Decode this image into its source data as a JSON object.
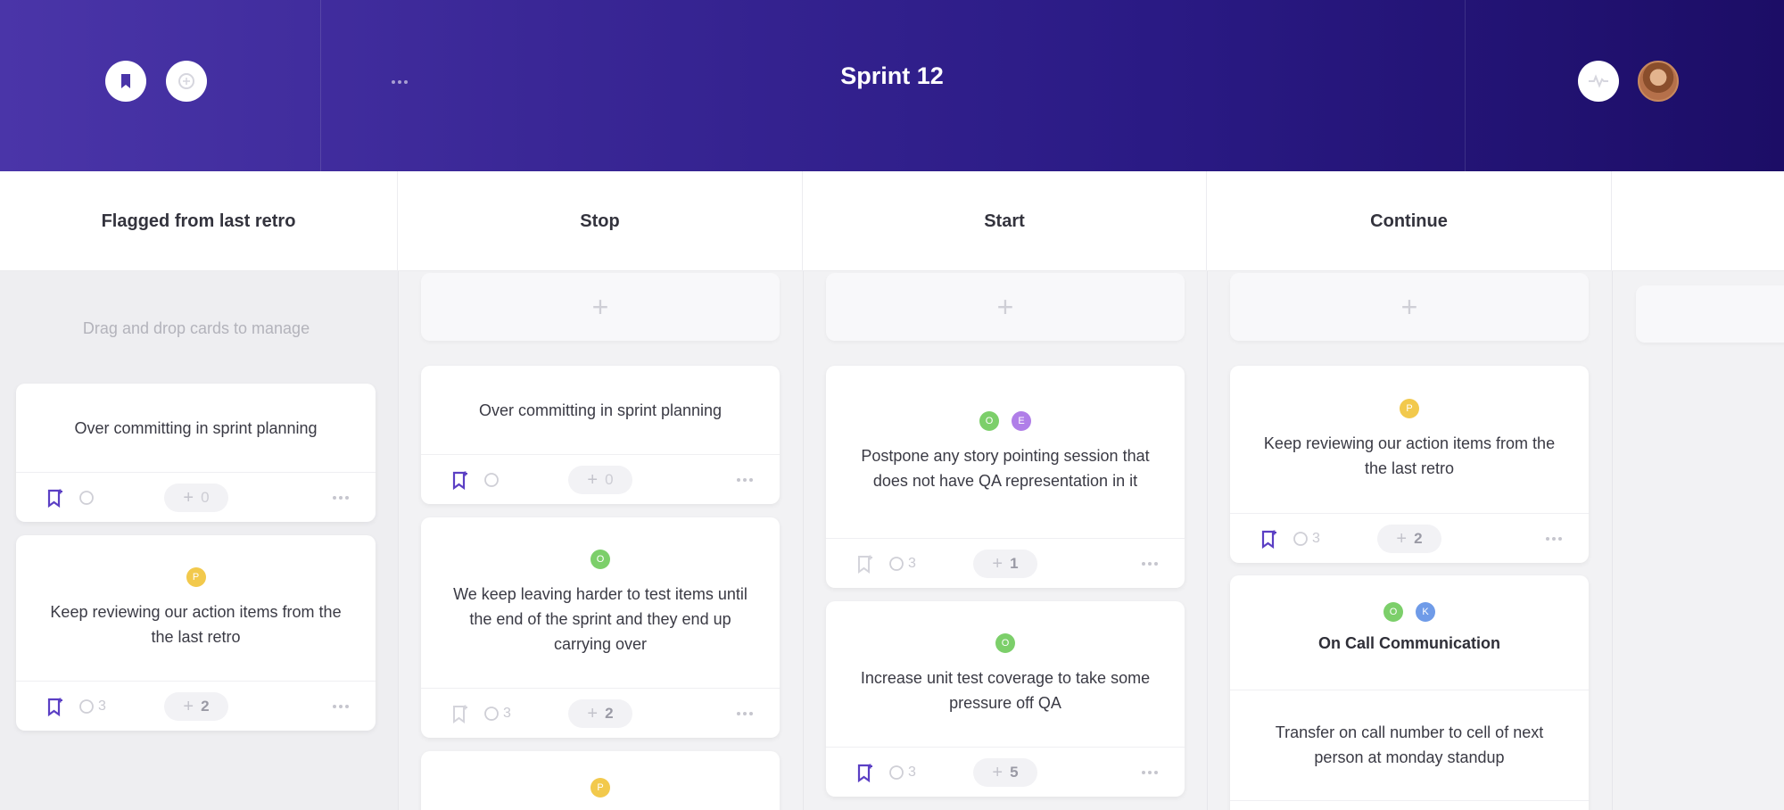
{
  "header": {
    "title": "Sprint 12",
    "left_buttons": [
      {
        "icon": "bookmark-icon"
      },
      {
        "icon": "chat-bubble-icon"
      }
    ],
    "more_icon": "more-dots-icon",
    "right": {
      "activity_icon": "activity-pulse-icon",
      "avatar": "user-avatar"
    }
  },
  "columns": [
    {
      "title": "Flagged from last retro",
      "hint": "Drag and drop cards to manage"
    },
    {
      "title": "Stop"
    },
    {
      "title": "Start"
    },
    {
      "title": "Continue"
    }
  ],
  "add_card_symbol": "+",
  "cards": {
    "flagged": [
      {
        "text": "Over committing in sprint planning",
        "comments": "",
        "votes": "0"
      },
      {
        "users": [
          "P"
        ],
        "text": "Keep reviewing our action items from the the last retro",
        "comments": "3",
        "votes": "2"
      }
    ],
    "stop": [
      {
        "text": "Over committing in sprint planning",
        "comments": "",
        "votes": "0"
      },
      {
        "users": [
          "O"
        ],
        "text": "We keep leaving harder to test items until the end of the sprint and they end up carrying over",
        "comments": "3",
        "votes": "2"
      },
      {
        "users": [
          "P"
        ]
      }
    ],
    "start": [
      {
        "users": [
          "O",
          "E"
        ],
        "text": "Postpone any story pointing session that does not have QA representation in it",
        "comments": "3",
        "votes": "1"
      },
      {
        "users": [
          "O"
        ],
        "text": "Increase unit test coverage to take some pressure off QA",
        "comments": "3",
        "votes": "5"
      }
    ],
    "continue": [
      {
        "users": [
          "P"
        ],
        "text": "Keep reviewing our action items from the the last retro",
        "comments": "3",
        "votes": "2"
      },
      {
        "users": [
          "O",
          "K"
        ],
        "title": "On Call Communication",
        "text": "Transfer on call number to cell of next person at monday standup"
      }
    ]
  },
  "colors": {
    "header_start": "#4a35a8",
    "header_end": "#1c0d66",
    "accent": "#5b3fc4",
    "user_P": "#f2c94c",
    "user_O": "#7ccf6a",
    "user_E": "#b07ee8",
    "user_K": "#6f9be8"
  }
}
